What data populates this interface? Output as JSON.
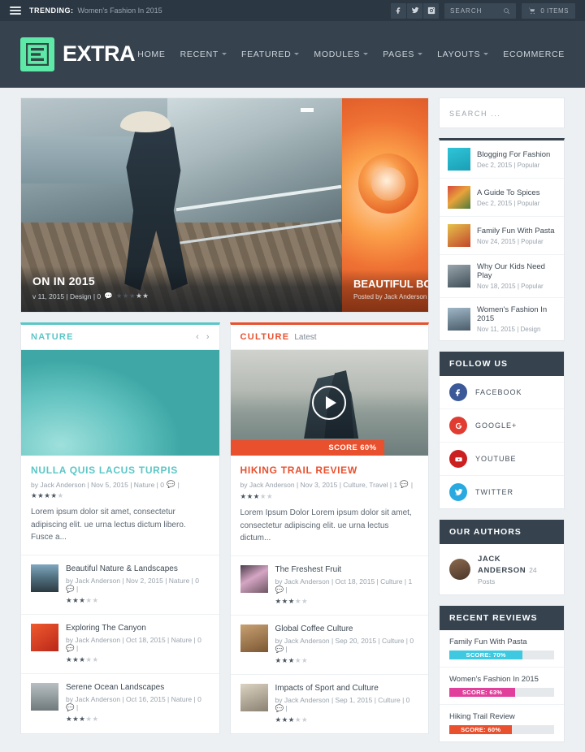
{
  "topbar": {
    "menu_icon": "hamburger-icon",
    "trending_label": "TRENDING:",
    "trending_text": "Women's Fashion In 2015",
    "social": [
      {
        "name": "facebook-icon",
        "label": "Facebook"
      },
      {
        "name": "twitter-icon",
        "label": "Twitter"
      },
      {
        "name": "instagram-icon",
        "label": "Instagram"
      }
    ],
    "search_label": "SEARCH",
    "search_icon": "magnifier-icon",
    "cart_icon": "cart-icon",
    "cart_label": "0 ITEMS"
  },
  "header": {
    "logo_text": "EXTRA",
    "logo_mark_color": "#5ee9a8",
    "nav": [
      {
        "label": "HOME",
        "has_dropdown": false
      },
      {
        "label": "RECENT",
        "has_dropdown": true
      },
      {
        "label": "FEATURED",
        "has_dropdown": true
      },
      {
        "label": "MODULES",
        "has_dropdown": true
      },
      {
        "label": "PAGES",
        "has_dropdown": true
      },
      {
        "label": "LAYOUTS",
        "has_dropdown": true
      },
      {
        "label": "ECOMMERCE",
        "has_dropdown": false
      }
    ]
  },
  "hero": {
    "slide1": {
      "title": "ON IN 2015",
      "meta": "v 11, 2015 | Design | 0",
      "comment_icon": "comment-icon",
      "stars_filled": 3,
      "stars_total": 5
    },
    "slide2": {
      "title": "BEAUTIFUL BOUQ",
      "meta": "Posted by Jack Anderson | No"
    }
  },
  "modules": [
    {
      "id": "nature",
      "title": "NATURE",
      "subtitle": "",
      "accent": "#5bc6c6",
      "prev_icon": "chevron-left-icon",
      "next_icon": "chevron-right-icon",
      "featured": {
        "title": "NULLA QUIS LACUS TURPIS",
        "meta": "by Jack Anderson | Nov 5, 2015 | Nature | 0",
        "comment_icon": "comment-icon",
        "stars_filled": 4,
        "stars_total": 5,
        "excerpt": "Lorem ipsum dolor sit amet, consectetur adipiscing elit. ue urna lectus dictum libero. Fusce a..."
      },
      "items": [
        {
          "title": "Beautiful Nature & Landscapes",
          "meta": "by Jack Anderson | Nov 2, 2015 | Nature | 0",
          "stars_filled": 3,
          "stars_total": 5,
          "thumb": "t-mtn"
        },
        {
          "title": "Exploring The Canyon",
          "meta": "by Jack Anderson | Oct 18, 2015 | Nature | 0",
          "stars_filled": 3,
          "stars_total": 5,
          "thumb": "t-red"
        },
        {
          "title": "Serene Ocean Landscapes",
          "meta": "by Jack Anderson | Oct 16, 2015 | Nature | 0",
          "stars_filled": 3,
          "stars_total": 5,
          "thumb": "t-gray"
        }
      ]
    },
    {
      "id": "culture",
      "title": "CULTURE",
      "subtitle": "Latest",
      "accent": "#e8502e",
      "featured": {
        "title": "HIKING TRAIL REVIEW",
        "meta": "by Jack Anderson | Nov 3, 2015 | Culture, Travel | 1",
        "comment_icon": "comment-icon",
        "stars_filled": 3,
        "stars_total": 5,
        "excerpt": "Lorem Ipsum Dolor Lorem ipsum dolor sit amet, consectetur adipiscing elit. ue urna lectus dictum...",
        "score_label": "SCORE 60%",
        "play_icon": "play-icon"
      },
      "items": [
        {
          "title": "The Freshest Fruit",
          "meta": "by Jack Anderson | Oct 18, 2015 | Culture | 1",
          "stars_filled": 3,
          "stars_total": 5,
          "thumb": "t-fruit"
        },
        {
          "title": "Global Coffee Culture",
          "meta": "by Jack Anderson | Sep 20, 2015 | Culture | 0",
          "stars_filled": 3,
          "stars_total": 5,
          "thumb": "t-coffee"
        },
        {
          "title": "Impacts of Sport and Culture",
          "meta": "by Jack Anderson | Sep 1, 2015 | Culture | 0",
          "stars_filled": 3,
          "stars_total": 5,
          "thumb": "t-sport"
        }
      ]
    }
  ],
  "sidebar": {
    "search_placeholder": "SEARCH ...",
    "posts": [
      {
        "title": "Blogging For Fashion",
        "meta": "Dec 2, 2015 | Popular",
        "thumb": "t-blog"
      },
      {
        "title": "A Guide To Spices",
        "meta": "Dec 2, 2015 | Popular",
        "thumb": "t-spice"
      },
      {
        "title": "Family Fun With Pasta",
        "meta": "Nov 24, 2015 | Popular",
        "thumb": "t-pasta"
      },
      {
        "title": "Why Our Kids Need Play",
        "meta": "Nov 18, 2015 | Popular",
        "thumb": "t-play"
      },
      {
        "title": "Women's Fashion In 2015",
        "meta": "Nov 11, 2015 | Design",
        "thumb": "t-fash"
      }
    ],
    "follow": {
      "heading": "FOLLOW US",
      "items": [
        {
          "label": "FACEBOOK",
          "icon": "facebook-icon",
          "color": "#3b5998"
        },
        {
          "label": "GOOGLE+",
          "icon": "google-plus-icon",
          "color": "#e03c31"
        },
        {
          "label": "YOUTUBE",
          "icon": "youtube-icon",
          "color": "#cc2020"
        },
        {
          "label": "TWITTER",
          "icon": "twitter-icon",
          "color": "#2aa9e0"
        }
      ]
    },
    "authors": {
      "heading": "OUR AUTHORS",
      "items": [
        {
          "name": "JACK ANDERSON",
          "posts": "24 Posts",
          "avatar": "avatar"
        }
      ]
    },
    "reviews": {
      "heading": "RECENT REVIEWS",
      "items": [
        {
          "title": "Family Fun With Pasta",
          "score_label": "SCORE: 70%",
          "percent": 70,
          "color": "#3ec9e0"
        },
        {
          "title": "Women's Fashion In 2015",
          "score_label": "SCORE: 63%",
          "percent": 63,
          "color": "#e0409b"
        },
        {
          "title": "Hiking Trail Review",
          "score_label": "SCORE: 60%",
          "percent": 60,
          "color": "#e8502e"
        }
      ]
    }
  }
}
